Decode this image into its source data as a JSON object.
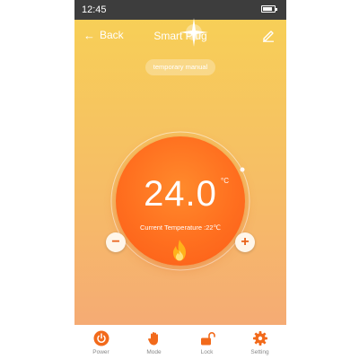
{
  "status_bar": {
    "time": "12:45",
    "battery_level": 0.85
  },
  "header": {
    "back_label": "Back",
    "title": "Smart Plug"
  },
  "mode_chip": "temporary manual",
  "dial": {
    "temperature": "24.0",
    "unit": "°C",
    "current_temperature_text": "Current Temperature :22℃",
    "minus_label": "−",
    "plus_label": "+"
  },
  "bottom_nav": {
    "items": [
      {
        "label": "Power",
        "icon": "power-icon"
      },
      {
        "label": "Mode",
        "icon": "hand-icon"
      },
      {
        "label": "Lock",
        "icon": "unlock-icon"
      },
      {
        "label": "Setting",
        "icon": "gear-icon"
      }
    ]
  },
  "colors": {
    "accent": "#ff6f1f",
    "gradient_top": "#f7cf57",
    "gradient_bottom": "#f5ab74",
    "nav_icon": "#f26a1b"
  }
}
